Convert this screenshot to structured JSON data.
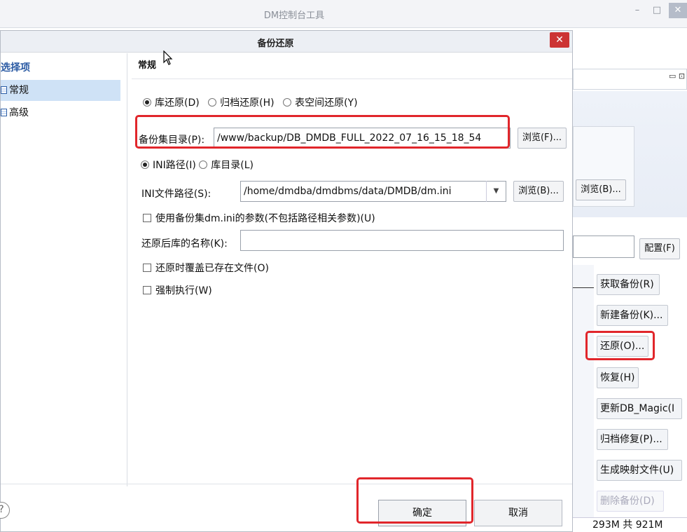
{
  "main_window": {
    "title": "DM控制台工具",
    "minimize": "–",
    "restore": "□",
    "close": "✕",
    "right_browse_label": "浏览(B)...",
    "configure_label": "配置(F)",
    "side_buttons": [
      {
        "label": "获取备份(R)"
      },
      {
        "label": "新建备份(K)..."
      },
      {
        "label": "还原(O)..."
      },
      {
        "label": "恢复(H)"
      },
      {
        "label": "更新DB_Magic(I"
      },
      {
        "label": "归档修复(P)..."
      },
      {
        "label": "生成映射文件(U)"
      },
      {
        "label": "删除备份(D)"
      }
    ],
    "status_text": "293M 共 921M"
  },
  "dialog": {
    "title": "备份还原",
    "close": "✕",
    "nav": {
      "heading": "选择项",
      "items": [
        {
          "label": "常规",
          "selected": true
        },
        {
          "label": "高级",
          "selected": false
        }
      ]
    },
    "section": "常规",
    "restore_type": {
      "options": [
        {
          "label": "库还原(D)",
          "checked": true
        },
        {
          "label": "归档还原(H)",
          "checked": false
        },
        {
          "label": "表空间还原(Y)",
          "checked": false
        }
      ]
    },
    "backup_dir": {
      "label": "备份集目录(P):",
      "value": "/www/backup/DB_DMDB_FULL_2022_07_16_15_18_54",
      "browse": "浏览(F)..."
    },
    "path_type": {
      "options": [
        {
          "label": "INI路径(I)",
          "checked": true
        },
        {
          "label": "库目录(L)",
          "checked": false
        }
      ]
    },
    "ini_path": {
      "label": "INI文件路径(S):",
      "value": "/home/dmdba/dmdbms/data/DMDB/dm.ini",
      "browse": "浏览(B)..."
    },
    "use_backup_ini": "使用备份集dm.ini的参数(不包括路径相关参数)(U)",
    "restored_name": {
      "label": "还原后库的名称(K):",
      "value": ""
    },
    "overwrite": "还原时覆盖已存在文件(O)",
    "force": "强制执行(W)",
    "help": "?",
    "ok": "确定",
    "cancel": "取消"
  },
  "colors": {
    "highlight_red": "#e1262b",
    "nav_selected": "#cfe2f6",
    "close_red": "#cc3333"
  }
}
